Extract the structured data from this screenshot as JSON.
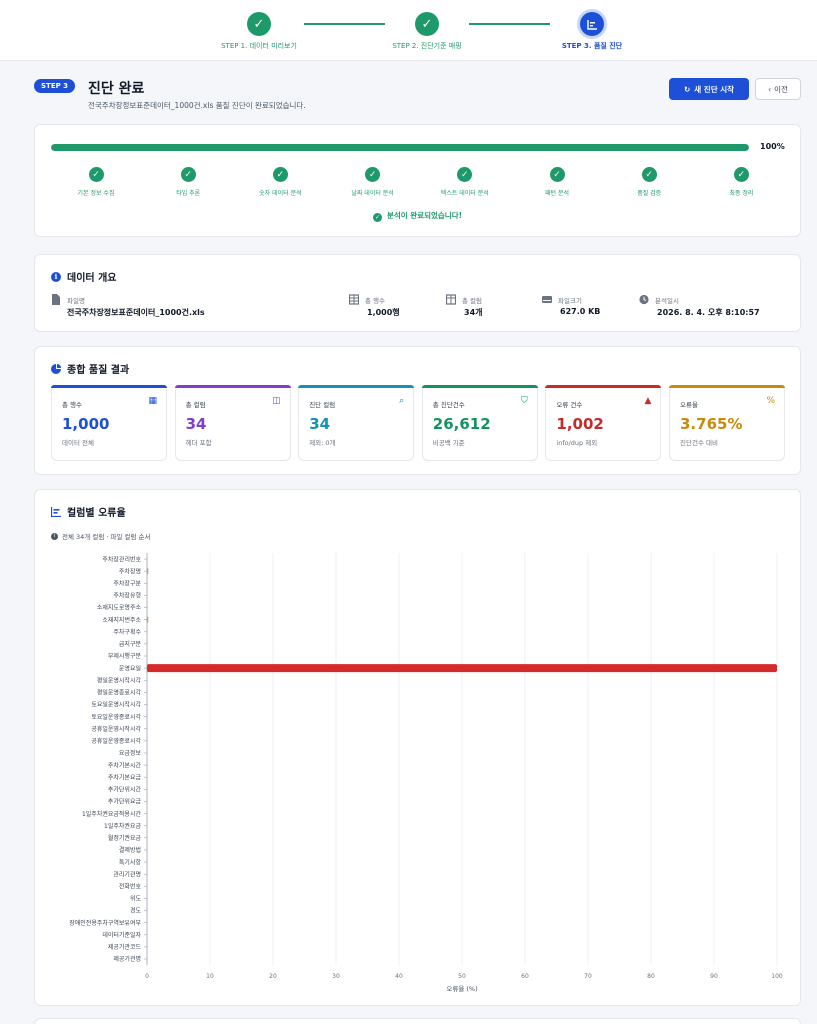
{
  "stepper": {
    "steps": [
      {
        "label": "STEP 1. 데이터 미리보기",
        "status": "done"
      },
      {
        "label": "STEP 2. 진단기준 매핑",
        "status": "done"
      },
      {
        "label": "STEP 3. 품질 진단",
        "status": "active"
      }
    ]
  },
  "header": {
    "badge": "STEP 3",
    "title": "진단 완료",
    "subtitle": "전국주차장정보표준데이터_1000건.xls 품질 진단이 완료되었습니다.",
    "new_button": "새 진단 시작",
    "prev_button": "이전"
  },
  "progress": {
    "percent_label": "100%",
    "fraction": 1.0,
    "phases": [
      "기본 정보 수집",
      "타입 추론",
      "숫자 데이터 분석",
      "날짜 데이터 분석",
      "텍스트 데이터 분석",
      "패턴 분석",
      "품질 검증",
      "최종 정리"
    ],
    "done_message": "분석이 완료되었습니다!"
  },
  "overview": {
    "title": "데이터 개요",
    "file_label": "파일명",
    "file_value": "전국주차장정보표준데이터_1000건.xls",
    "rows_label": "총 행수",
    "rows_value": "1,000행",
    "cols_label": "총 컬럼",
    "cols_value": "34개",
    "size_label": "파일크기",
    "size_value": "627.0 KB",
    "time_label": "분석일시",
    "time_value": "2026. 8. 4. 오후 8:10:57"
  },
  "quality": {
    "title": "종합 품질 결과",
    "metrics": [
      {
        "label": "총 행수",
        "value": "1,000",
        "sub": "데이터 전체",
        "color": "#1d4fd7",
        "icon": "table-icon"
      },
      {
        "label": "총 컬럼",
        "value": "34",
        "sub": "헤더 포함",
        "color": "#7e3fcf",
        "icon": "columns-icon"
      },
      {
        "label": "진단 컬럼",
        "value": "34",
        "sub": "제외: 0개",
        "color": "#1391b8",
        "icon": "search-icon"
      },
      {
        "label": "총 진단건수",
        "value": "26,612",
        "sub": "비공백 기준",
        "color": "#15935f",
        "icon": "shield-icon"
      },
      {
        "label": "오류 건수",
        "value": "1,002",
        "sub": "info/dup 제외",
        "color": "#c92a2a",
        "icon": "warning-icon"
      },
      {
        "label": "오류율",
        "value": "3.765%",
        "sub": "진단건수 대비",
        "color": "#c98a0a",
        "icon": "percent-icon"
      }
    ]
  },
  "chart_section": {
    "title": "컬럼별 오류율",
    "note": "전체 34개 컬럼 · 파일 컬럼 순서"
  },
  "chart_data": {
    "type": "bar",
    "orientation": "horizontal",
    "xlabel": "오류율 (%)",
    "xlim": [
      0,
      100
    ],
    "xticks": [
      0,
      10,
      20,
      30,
      40,
      50,
      60,
      70,
      80,
      90,
      100
    ],
    "bar_color": "#d42a2a",
    "small_bar_color": "#e8925a",
    "grid": true,
    "categories": [
      "주차장관리번호",
      "주차장명",
      "주차장구분",
      "주차장유형",
      "소재지도로명주소",
      "소재지지번주소",
      "주차구획수",
      "급지구분",
      "부제시행구분",
      "운영요일",
      "평일운영시작시각",
      "평일운영종료시각",
      "토요일운영시작시각",
      "토요일운영종료시각",
      "공휴일운영시작시각",
      "공휴일운영종료시각",
      "요금정보",
      "주차기본시간",
      "주차기본요금",
      "추가단위시간",
      "추가단위요금",
      "1일주차권요금적용시간",
      "1일주차권요금",
      "월정기권요금",
      "결제방법",
      "특기사항",
      "관리기관명",
      "전화번호",
      "위도",
      "경도",
      "장애인전용주차구역보유여부",
      "데이터기준일자",
      "제공기관코드",
      "제공기관명"
    ],
    "values": [
      0,
      0.2,
      0,
      0,
      0,
      0.2,
      0,
      0,
      0,
      100,
      0,
      0,
      0,
      0,
      0,
      0,
      0,
      0,
      0,
      0,
      0,
      0,
      0,
      0,
      0,
      0,
      0,
      0,
      0,
      0,
      0,
      0,
      0,
      0
    ]
  }
}
